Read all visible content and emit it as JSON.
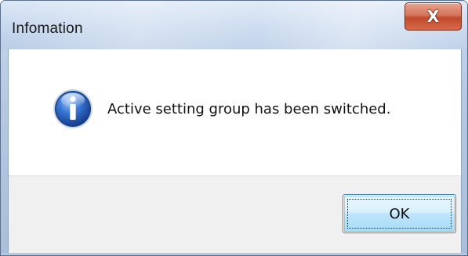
{
  "window": {
    "title": "Infomation",
    "close_label": "X"
  },
  "dialog": {
    "icon": "info-icon",
    "message": "Active setting group has been switched."
  },
  "buttons": {
    "ok_label": "OK"
  },
  "colors": {
    "title_bar": "#c3d5ec",
    "close_button": "#c24a2d",
    "button_area": "#f0f0f0",
    "ok_button_border": "#3c7fb1",
    "info_icon_blue": "#1f5fbf"
  }
}
